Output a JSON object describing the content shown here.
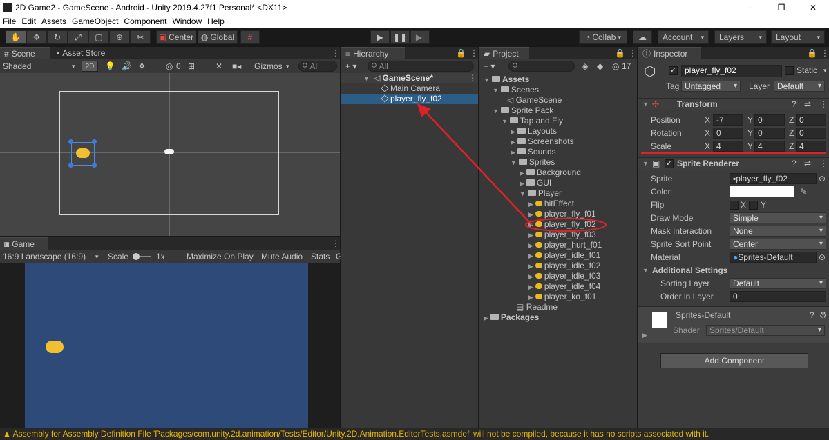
{
  "window": {
    "title": "2D Game2 - GameScene - Android - Unity 2019.4.27f1 Personal* <DX11>",
    "min": "─",
    "max": "❐",
    "close": "✕"
  },
  "menu": [
    "File",
    "Edit",
    "Assets",
    "GameObject",
    "Component",
    "Window",
    "Help"
  ],
  "toolbar": {
    "center": "Center",
    "global": "Global",
    "collab": "Collab",
    "account": "Account",
    "layers": "Layers",
    "layout": "Layout"
  },
  "scene": {
    "tab": "Scene",
    "tab2": "Asset Store",
    "shaded": "Shaded",
    "mode2d": "2D",
    "hidden_count": "0",
    "gizmos": "Gizmos",
    "search_placeholder": "All"
  },
  "game": {
    "tab": "Game",
    "aspect": "16:9 Landscape (16:9)",
    "scale_label": "Scale",
    "scale_value": "1x",
    "maximize": "Maximize On Play",
    "mute": "Mute Audio",
    "stats": "Stats",
    "gizmos_cut": "G"
  },
  "hierarchy": {
    "tab": "Hierarchy",
    "search_placeholder": "All",
    "scene": "GameScene*",
    "items": [
      "Main Camera",
      "player_fly_f02"
    ]
  },
  "project": {
    "tab": "Project",
    "count": "17",
    "tree": [
      {
        "label": "Assets",
        "depth": 0,
        "kind": "folder",
        "bold": true
      },
      {
        "label": "Scenes",
        "depth": 1,
        "kind": "folder"
      },
      {
        "label": "GameScene",
        "depth": 2,
        "kind": "unity"
      },
      {
        "label": "Sprite Pack",
        "depth": 1,
        "kind": "folder"
      },
      {
        "label": "Tap and Fly",
        "depth": 2,
        "kind": "folder"
      },
      {
        "label": "Layouts",
        "depth": 3,
        "kind": "folder",
        "collapsed": true
      },
      {
        "label": "Screenshots",
        "depth": 3,
        "kind": "folder",
        "collapsed": true
      },
      {
        "label": "Sounds",
        "depth": 3,
        "kind": "folder",
        "collapsed": true
      },
      {
        "label": "Sprites",
        "depth": 3,
        "kind": "folder"
      },
      {
        "label": "Background",
        "depth": 4,
        "kind": "folder",
        "collapsed": true
      },
      {
        "label": "GUI",
        "depth": 4,
        "kind": "folder",
        "collapsed": true
      },
      {
        "label": "Player",
        "depth": 4,
        "kind": "folder"
      },
      {
        "label": "hitEffect",
        "depth": 5,
        "kind": "sprite"
      },
      {
        "label": "player_fly_f01",
        "depth": 5,
        "kind": "sprite"
      },
      {
        "label": "player_fly_f02",
        "depth": 5,
        "kind": "sprite",
        "highlight": true
      },
      {
        "label": "player_fly_f03",
        "depth": 5,
        "kind": "sprite"
      },
      {
        "label": "player_hurt_f01",
        "depth": 5,
        "kind": "sprite"
      },
      {
        "label": "player_idle_f01",
        "depth": 5,
        "kind": "sprite"
      },
      {
        "label": "player_idle_f02",
        "depth": 5,
        "kind": "sprite"
      },
      {
        "label": "player_idle_f03",
        "depth": 5,
        "kind": "sprite"
      },
      {
        "label": "player_idle_f04",
        "depth": 5,
        "kind": "sprite"
      },
      {
        "label": "player_ko_f01",
        "depth": 5,
        "kind": "sprite"
      },
      {
        "label": "Readme",
        "depth": 3,
        "kind": "doc"
      },
      {
        "label": "Packages",
        "depth": 0,
        "kind": "folder",
        "bold": true,
        "collapsed": true
      }
    ]
  },
  "inspector": {
    "tab": "Inspector",
    "object_name": "player_fly_f02",
    "static": "Static",
    "tag_label": "Tag",
    "tag": "Untagged",
    "layer_label": "Layer",
    "layer": "Default",
    "transform": {
      "title": "Transform",
      "rows": [
        {
          "label": "Position",
          "x": "-7",
          "y": "0",
          "z": "0"
        },
        {
          "label": "Rotation",
          "x": "0",
          "y": "0",
          "z": "0"
        },
        {
          "label": "Scale",
          "x": "4",
          "y": "4",
          "z": "4"
        }
      ]
    },
    "sprite_renderer": {
      "title": "Sprite Renderer",
      "sprite_label": "Sprite",
      "sprite": "player_fly_f02",
      "color_label": "Color",
      "flip_label": "Flip",
      "flip_x": "X",
      "flip_y": "Y",
      "draw_mode_label": "Draw Mode",
      "draw_mode": "Simple",
      "mask_label": "Mask Interaction",
      "mask": "None",
      "sort_point_label": "Sprite Sort Point",
      "sort_point": "Center",
      "material_label": "Material",
      "material": "Sprites-Default",
      "additional": "Additional Settings",
      "sorting_layer_label": "Sorting Layer",
      "sorting_layer": "Default",
      "order_label": "Order in Layer",
      "order": "0"
    },
    "material_block": {
      "name": "Sprites-Default",
      "shader_label": "Shader",
      "shader": "Sprites/Default"
    },
    "add_component": "Add Component"
  },
  "status": "Assembly for Assembly Definition File 'Packages/com.unity.2d.animation/Tests/Editor/Unity.2D.Animation.EditorTests.asmdef' will not be compiled, because it has no scripts associated with it.",
  "colors": {
    "accent_blue": "#2c5d87",
    "game_bg": "#2e4a78",
    "annotation_red": "#e0212a",
    "warning": "#e9b600"
  }
}
